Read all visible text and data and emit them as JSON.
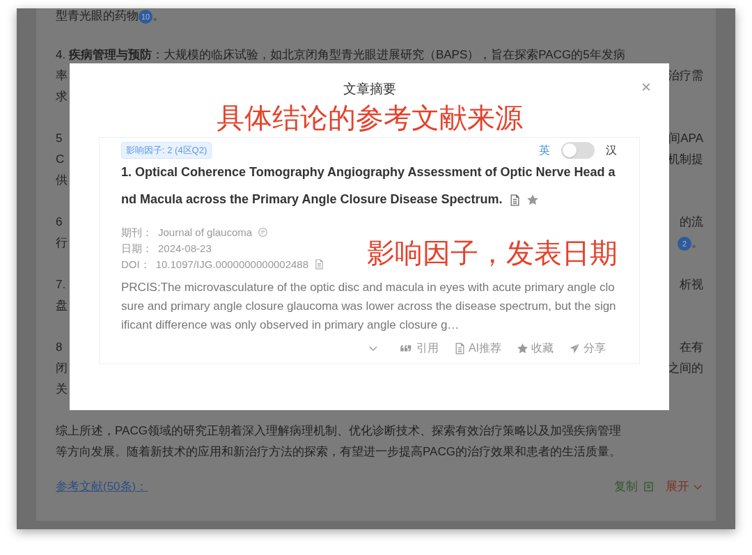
{
  "page": {
    "paragraphs": [
      {
        "lines": [
          {
            "left": [
              {
                "kind": "text",
                "text": "型青光眼的药物"
              },
              {
                "kind": "badge",
                "text": "10"
              },
              {
                "kind": "text",
                "text": "。"
              }
            ]
          }
        ]
      },
      {
        "lines": [
          {
            "left": [
              {
                "kind": "text",
                "text": "4. **疾病管理与预防**：大规模的临床试验，如北京闭角型青光眼进展研究（BAPS），旨在探索PACG的5年发病"
              }
            ]
          },
          {
            "left": [
              {
                "kind": "text",
                "text": "率"
              }
            ],
            "right": [
              {
                "kind": "text",
                "text": "治疗需"
              }
            ]
          },
          {
            "left": [
              {
                "kind": "text",
                "text": "求"
              }
            ]
          }
        ]
      },
      {
        "lines": [
          {
            "left": [
              {
                "kind": "text",
                "text": "5"
              }
            ],
            "right": [
              {
                "kind": "text",
                "text": "间APA"
              }
            ]
          },
          {
            "left": [
              {
                "kind": "text",
                "text": "C"
              }
            ],
            "right": [
              {
                "kind": "text",
                "text": "机制提"
              }
            ]
          },
          {
            "left": [
              {
                "kind": "text",
                "text": "供"
              }
            ]
          }
        ]
      },
      {
        "lines": [
          {
            "left": [
              {
                "kind": "text",
                "text": "6"
              }
            ],
            "right": [
              {
                "kind": "text",
                "text": "的流"
              }
            ]
          },
          {
            "left": [
              {
                "kind": "text",
                "text": "行"
              }
            ],
            "right": [
              {
                "kind": "badge",
                "text": "2"
              },
              {
                "kind": "text",
                "text": "。"
              }
            ]
          }
        ]
      },
      {
        "lines": [
          {
            "left": [
              {
                "kind": "text",
                "text": "7."
              }
            ],
            "right": [
              {
                "kind": "text",
                "text": "析视"
              }
            ]
          },
          {
            "left": [
              {
                "kind": "text",
                "text": "盘"
              }
            ]
          }
        ]
      },
      {
        "lines": [
          {
            "left": [
              {
                "kind": "text",
                "text": "8"
              }
            ],
            "right": [
              {
                "kind": "text",
                "text": "在有"
              }
            ]
          },
          {
            "left": [
              {
                "kind": "text",
                "text": "闭"
              }
            ],
            "right": [
              {
                "kind": "text",
                "text": "之间的"
              }
            ]
          },
          {
            "left": [
              {
                "kind": "text",
                "text": "关"
              }
            ]
          }
        ]
      },
      {
        "lines": [
          {
            "left": [
              {
                "kind": "text",
                "text": "综上所述，PACG领域的研究正朝着深入理解病理机制、优化诊断技术、探索有效治疗策略以及加强疾病管理"
              }
            ]
          },
          {
            "left": [
              {
                "kind": "text",
                "text": "等方向发展。随着新技术的应用和新治疗方法的探索，有望进一步提高PACG的治疗效果和患者的生活质量。"
              }
            ]
          }
        ]
      }
    ],
    "references": {
      "label": "参考文献(50条)：",
      "copy": "复制",
      "expand": "展开"
    }
  },
  "modal": {
    "title": "文章摘要",
    "close": "×",
    "annotations": [
      "具体结论的参考文献来源",
      "影响因子，发表日期"
    ],
    "article": {
      "impact_tag": "影响因子: 2 (4区Q2)",
      "lang_left": "英",
      "lang_right": "汉",
      "translate_on": false,
      "title": "1. Optical Coherence Tomography Angiography Assessment of Optic Nerve Head and Macula across the Primary Angle Closure Disease Spectrum.",
      "meta": [
        {
          "label": "期刊：",
          "value": "Journal of glaucoma"
        },
        {
          "label": "日期：",
          "value": "2024-08-23"
        },
        {
          "label": "DOI：",
          "value": "10.1097/IJG.0000000000002488"
        }
      ],
      "abstract": "PRCIS:The microvasculature of the optic disc and macula in eyes with acute primary angle closure and primary angle closure glaucoma was lower across the disease spectrum, but the significant difference was only observed in primary angle closure g…",
      "actions": [
        {
          "label": "引用"
        },
        {
          "label": "AI推荐"
        },
        {
          "label": "收藏"
        },
        {
          "label": "分享"
        }
      ]
    }
  }
}
